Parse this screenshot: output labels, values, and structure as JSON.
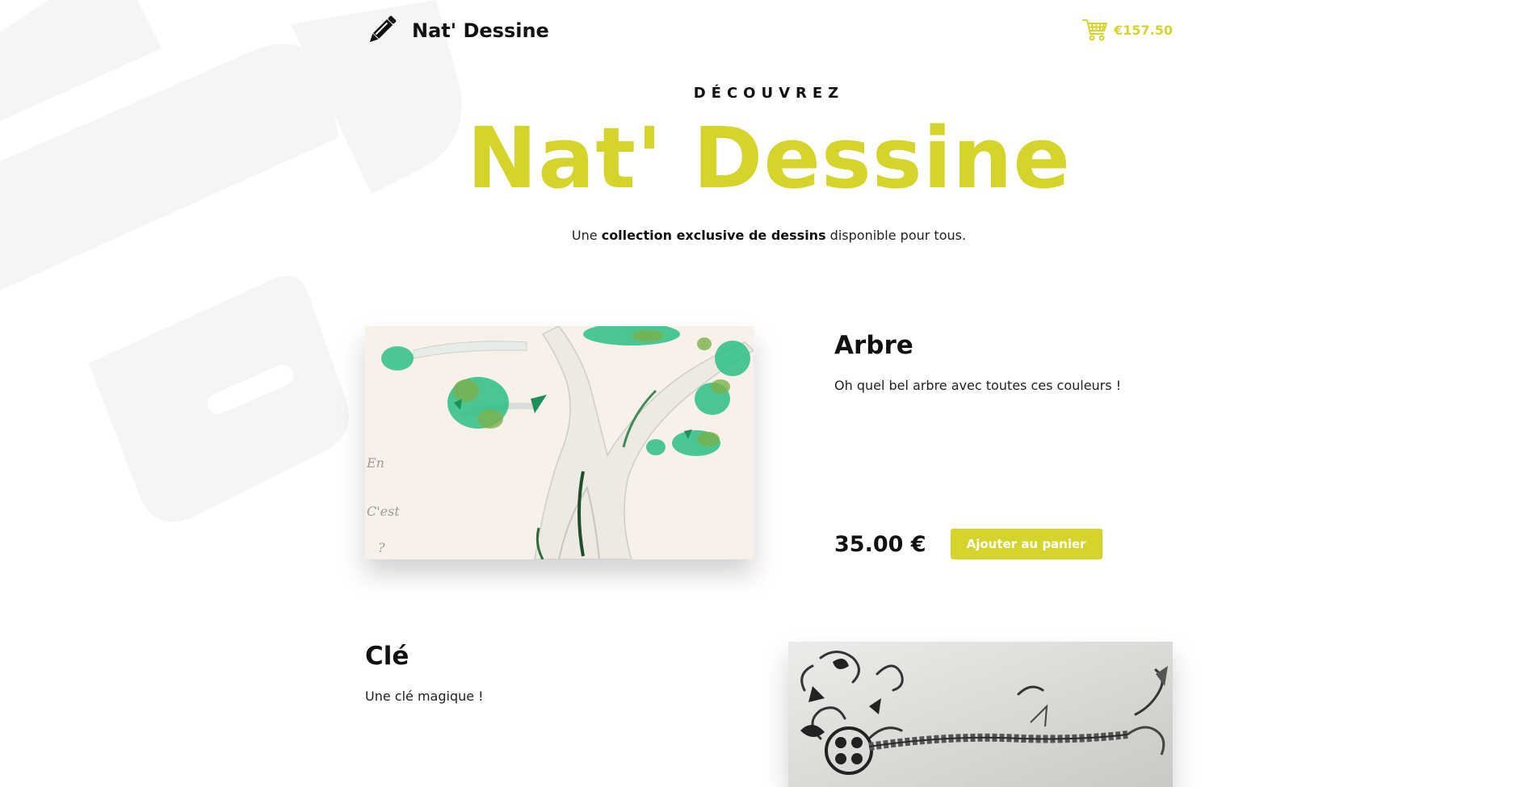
{
  "header": {
    "brand_name": "Nat' Dessine",
    "brand_icon": "pencil-icon",
    "cart_icon": "cart-icon",
    "cart_total": "€157.50"
  },
  "hero": {
    "kicker": "DÉCOUVREZ",
    "title": "Nat' Dessine",
    "tagline_before": "Une ",
    "tagline_bold": "collection exclusive de dessins",
    "tagline_after": " disponible pour tous."
  },
  "products": [
    {
      "title": "Arbre",
      "description": "Oh quel bel arbre avec toutes ces couleurs !",
      "price": "35.00 €",
      "button_label": "Ajouter au panier"
    },
    {
      "title": "Clé",
      "description": "Une clé magique !"
    }
  ],
  "colors": {
    "accent": "#d4d42c",
    "text": "#111111",
    "background_deco": "#f5f5f5"
  }
}
